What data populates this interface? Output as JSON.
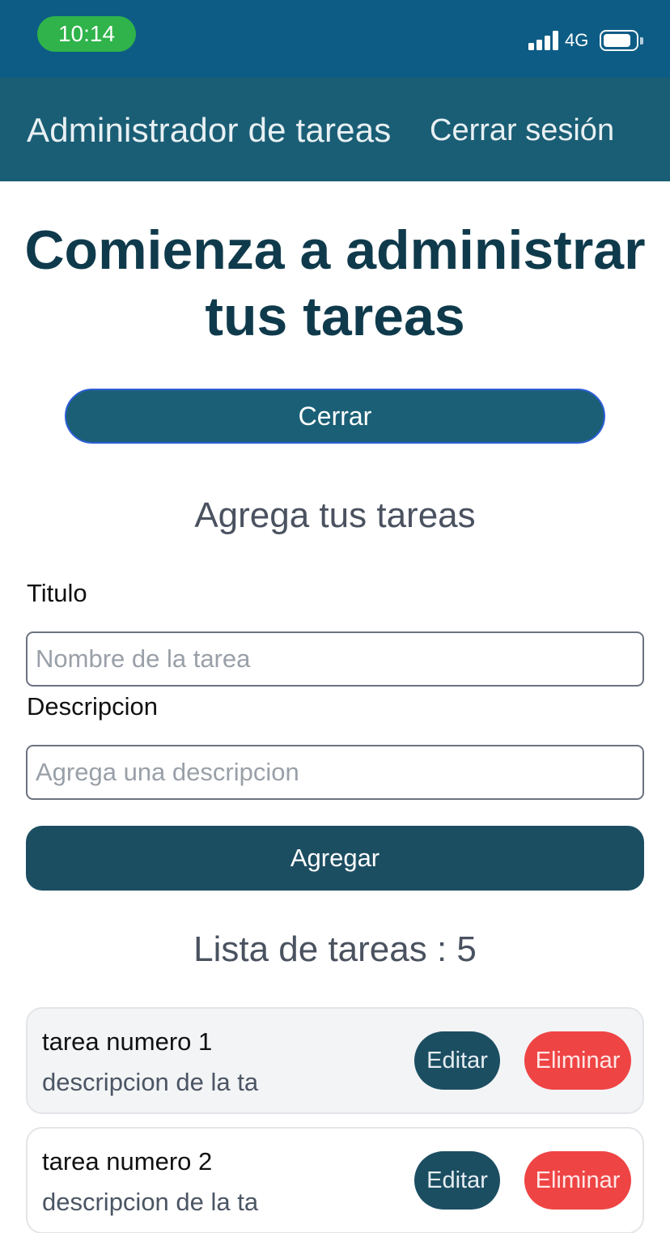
{
  "status_bar": {
    "time": "10:14",
    "network": "4G",
    "icons": [
      "signal-icon",
      "battery-icon"
    ],
    "colors": {
      "background": "#0d5c85",
      "time_pill": "#2fb34a"
    }
  },
  "navbar": {
    "brand": "Administrador de tareas",
    "logout": "Cerrar sesión",
    "colors": {
      "background": "#1a5e75"
    }
  },
  "hero": {
    "title_line1": "Comienza a administrar",
    "title_line2": "tus tareas"
  },
  "close_button": {
    "label": "Cerrar"
  },
  "add_section": {
    "title": "Agrega tus tareas",
    "title_label": "Titulo",
    "title_placeholder": "Nombre de la tarea",
    "desc_label": "Descripcion",
    "desc_placeholder": "Agrega una descripcion",
    "submit_label": "Agregar"
  },
  "list_section": {
    "title": "Lista de tareas : 5",
    "tasks": [
      {
        "title": "tarea numero 1",
        "description": "descripcion de la ta",
        "edit_label": "Editar",
        "delete_label": "Eliminar"
      },
      {
        "title": "tarea numero 2",
        "description": "descripcion de la ta",
        "edit_label": "Editar",
        "delete_label": "Eliminar"
      }
    ]
  },
  "colors": {
    "primary": "#1c4e62",
    "danger": "#ef4444",
    "heading": "#0f3a4c"
  }
}
